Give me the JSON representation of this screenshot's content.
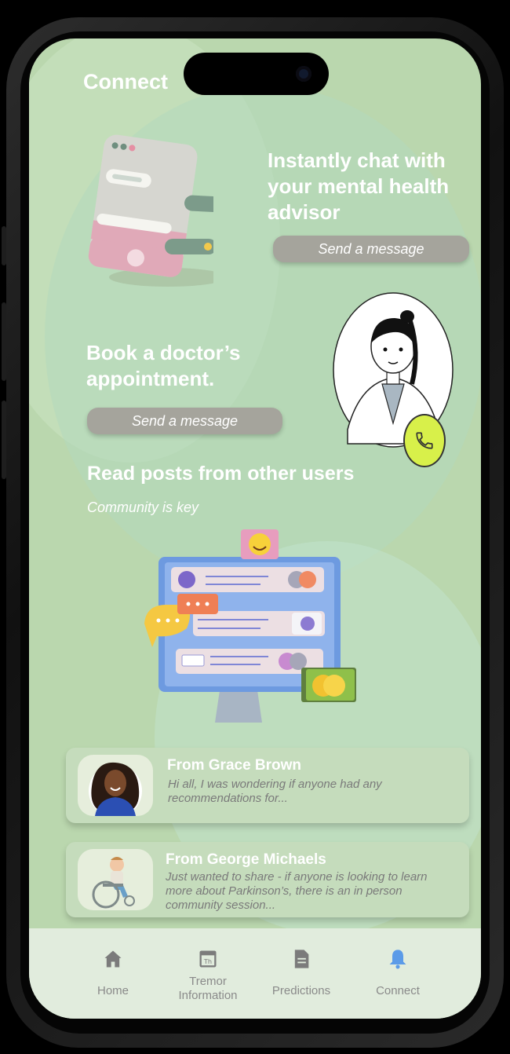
{
  "header": {
    "title": "Connect"
  },
  "chat_section": {
    "heading_lines": [
      "Instantly chat with",
      "your mental health",
      "advisor"
    ],
    "button_label": "Send a message"
  },
  "doctor_section": {
    "heading_lines": [
      "Book a doctor’s",
      "appointment."
    ],
    "button_label": "Send a message"
  },
  "community_section": {
    "heading": "Read posts from other users",
    "subheading": "Community is key"
  },
  "posts": [
    {
      "from": "From Grace Brown",
      "lines": [
        "Hi all, I was wondering if anyone had any",
        "recommendations for..."
      ]
    },
    {
      "from": "From George Michaels",
      "lines": [
        "Just wanted to share - if anyone is looking to learn",
        "more about Parkinson’s, there is an in person",
        "community session..."
      ]
    }
  ],
  "nav": {
    "items": [
      {
        "label_lines": [
          "Home"
        ],
        "icon": "home-icon"
      },
      {
        "label_lines": [
          "Tremor",
          "Information"
        ],
        "icon": "calendar-icon"
      },
      {
        "label_lines": [
          "Predictions"
        ],
        "icon": "document-icon"
      },
      {
        "label_lines": [
          "Connect"
        ],
        "icon": "bell-icon"
      }
    ],
    "active_color": "#5b9be8",
    "inactive_color": "#7b7b7b"
  },
  "colors": {
    "background": "#bad7ae",
    "button": "#a5a49c",
    "accent_phone": "#d8f04a"
  }
}
